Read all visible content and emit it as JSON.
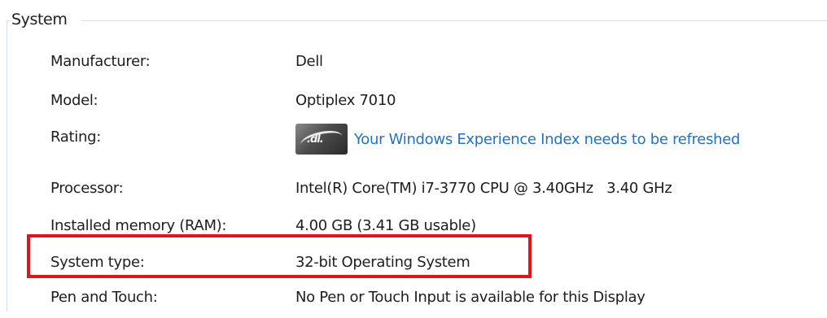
{
  "group": {
    "title": "System"
  },
  "rows": {
    "manufacturer": {
      "label": "Manufacturer:",
      "value": "Dell"
    },
    "model": {
      "label": "Model:",
      "value": "Optiplex 7010"
    },
    "rating": {
      "label": "Rating:",
      "link": "Your Windows Experience Index needs to be refreshed",
      "icon": "windows-experience-index-icon"
    },
    "processor": {
      "label": "Processor:",
      "value": "Intel(R) Core(TM) i7-3770 CPU @ 3.40GHz   3.40 GHz"
    },
    "memory": {
      "label": "Installed memory (RAM):",
      "value": "4.00 GB (3.41 GB usable)"
    },
    "system_type": {
      "label": "System type:",
      "value": "32-bit Operating System"
    },
    "pen_touch": {
      "label": "Pen and Touch:",
      "value": "No Pen or Touch Input is available for this Display"
    }
  },
  "colors": {
    "link": "#1e73c8",
    "highlight": "#e1131b",
    "group_border": "#d5dfe5"
  }
}
